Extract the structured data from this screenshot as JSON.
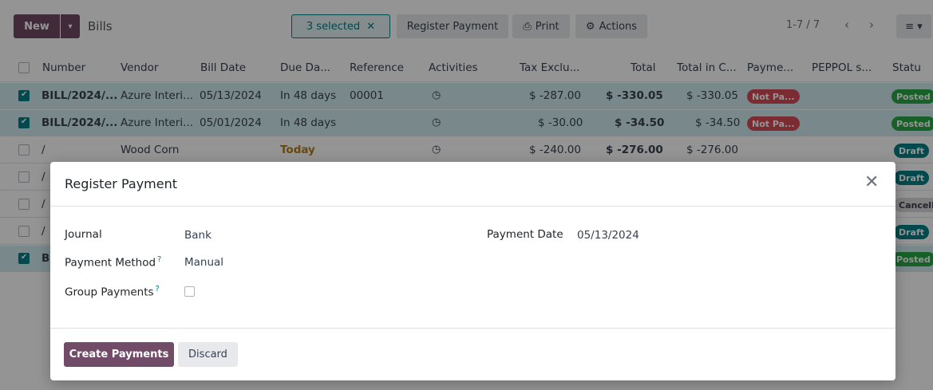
{
  "controlbar": {
    "new_label": "New",
    "breadcrumb": "Bills",
    "selected_label": "3 selected",
    "register_label": "Register Payment",
    "print_label": "Print",
    "actions_label": "Actions",
    "pager": "1-7 / 7"
  },
  "table": {
    "headers": {
      "number": "Number",
      "vendor": "Vendor",
      "bill_date": "Bill Date",
      "due_date": "Due Da...",
      "reference": "Reference",
      "activities": "Activities",
      "tax_excl": "Tax Exclu...",
      "total": "Total",
      "total_c": "Total in C...",
      "payment": "Payme...",
      "peppol": "PEPPOL s...",
      "status": "Statu"
    },
    "rows": [
      {
        "number": "BILL/2024/...",
        "vendor": "Azure Interi...",
        "bill_date": "05/13/2024",
        "due": "In 48 days",
        "reference": "00001",
        "tax": "$ -287.00",
        "total": "$ -330.05",
        "total_c": "$ -330.05",
        "payment": "Not Pa...",
        "status": "Posted"
      },
      {
        "number": "BILL/2024/...",
        "vendor": "Azure Interi...",
        "bill_date": "05/01/2024",
        "due": "In 48 days",
        "reference": "",
        "tax": "$ -30.00",
        "total": "$ -34.50",
        "total_c": "$ -34.50",
        "payment": "Not Pa...",
        "status": "Posted"
      },
      {
        "number": "/",
        "vendor": "Wood Corn",
        "bill_date": "",
        "due": "Today",
        "reference": "",
        "tax": "$ -240.00",
        "total": "$ -276.00",
        "total_c": "$ -276.00",
        "payment": "",
        "status": "Draft"
      },
      {
        "number": "/",
        "status": "Draft"
      },
      {
        "number": "/",
        "status": "Cancell"
      },
      {
        "number": "/",
        "status": "Draft"
      },
      {
        "number": "B",
        "status": "Posted"
      }
    ]
  },
  "modal": {
    "title": "Register Payment",
    "journal_label": "Journal",
    "journal_value": "Bank",
    "method_label": "Payment Method",
    "method_value": "Manual",
    "group_label": "Group Payments",
    "date_label": "Payment Date",
    "date_value": "05/13/2024",
    "help_mark": "?",
    "create_label": "Create Payments",
    "discard_label": "Discard"
  },
  "colors": {
    "primary": "#714b67",
    "teal": "#017e84",
    "posted": "#28a745",
    "not_paid": "#d44c59"
  }
}
